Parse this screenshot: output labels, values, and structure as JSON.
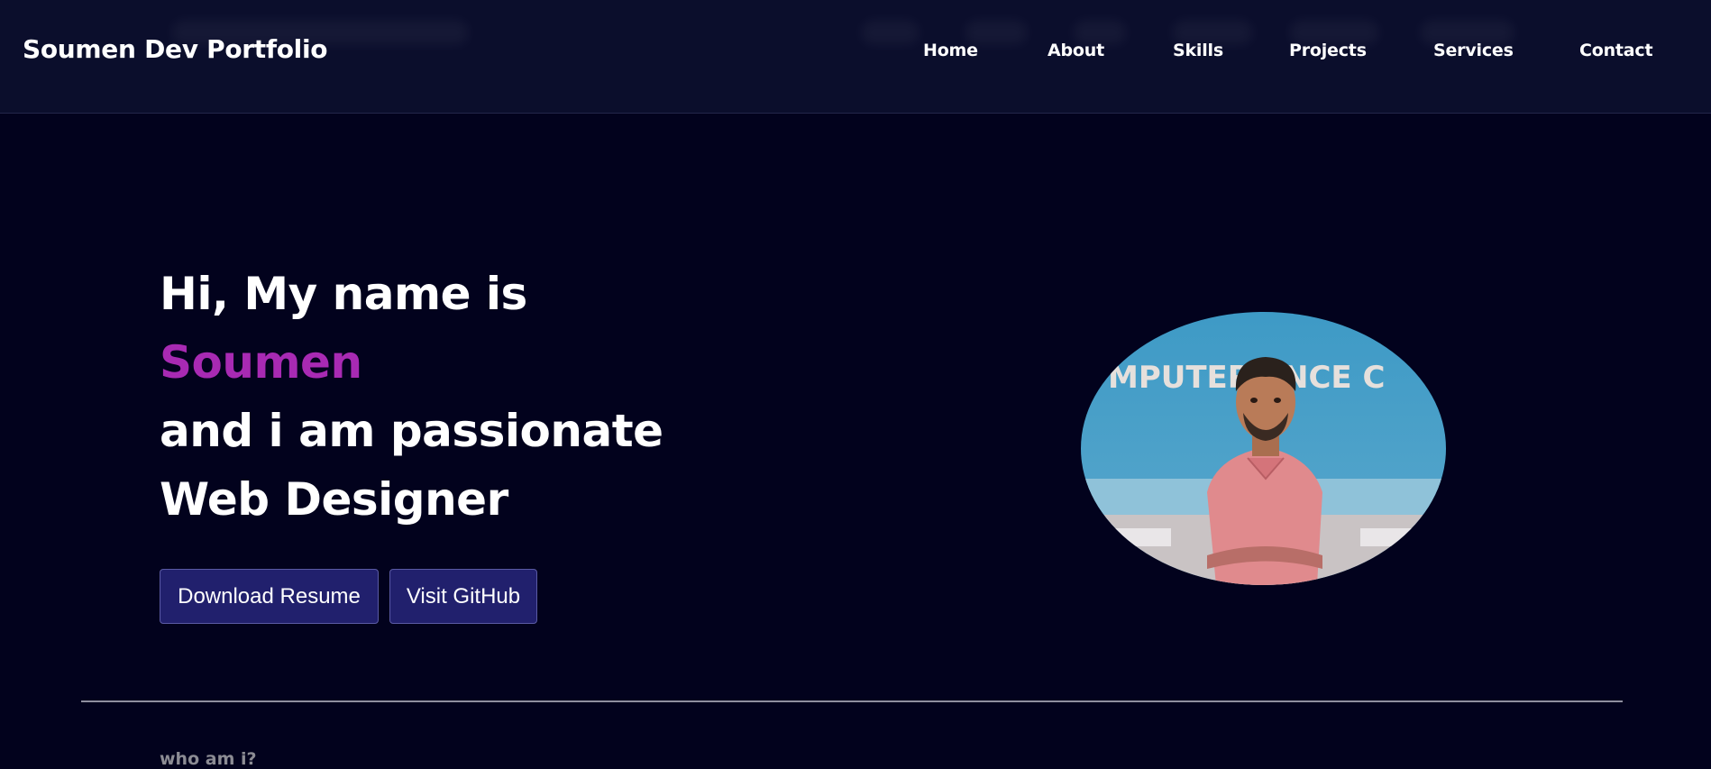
{
  "nav": {
    "brand": "Soumen Dev Portfolio",
    "links": [
      "Home",
      "About",
      "Skills",
      "Projects",
      "Services",
      "Contact"
    ]
  },
  "hero": {
    "line1": "Hi, My name is",
    "name": "Soumen",
    "line3": "and i am passionate",
    "line4": "Web Designer",
    "buttons": {
      "resume": "Download Resume",
      "github": "Visit GitHub"
    },
    "photo_text": "MPUTER ENCE C"
  },
  "about": {
    "subtitle": "who am i?"
  },
  "colors": {
    "background": "#02021d",
    "navbar": "#0b0e2c",
    "accent_name": "#a82ab3",
    "button": "#21206d"
  }
}
